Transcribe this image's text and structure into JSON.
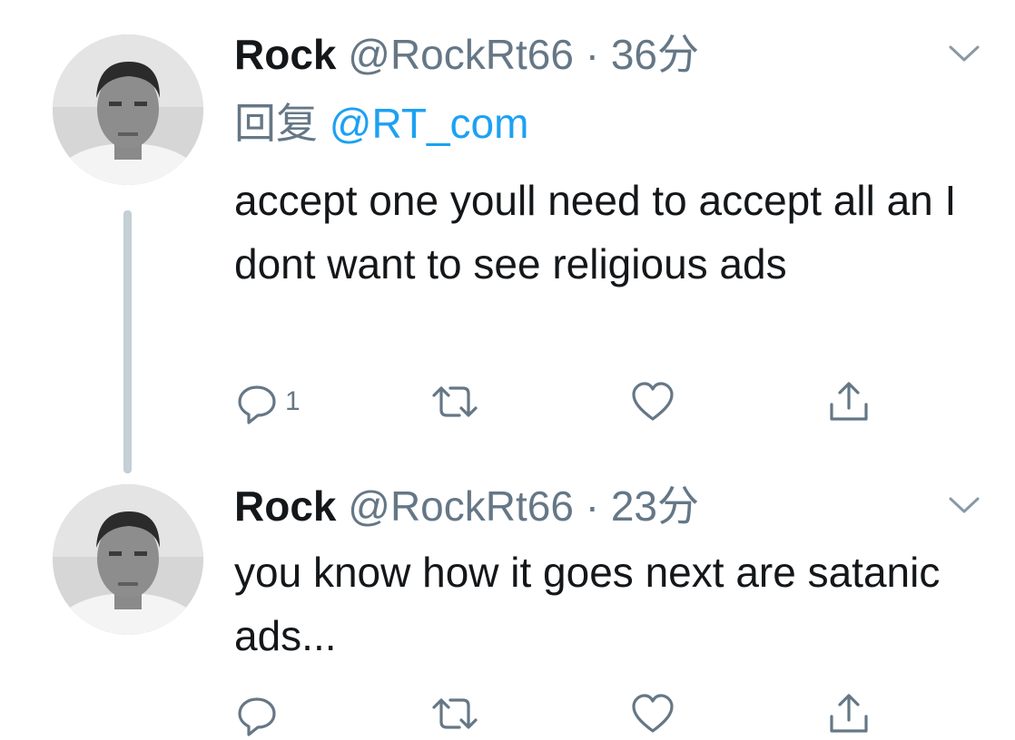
{
  "tweets": [
    {
      "name": "Rock",
      "handle": "@RockRt66",
      "separator": "·",
      "time": "36分",
      "reply_label": "回复",
      "reply_mention": "@RT_com",
      "text": "accept one youll need to accept all an I dont want to see religious ads",
      "reply_count": "1",
      "icons": {
        "reply": "reply-icon",
        "retweet": "retweet-icon",
        "like": "like-icon",
        "share": "share-icon",
        "menu": "chevron-down-icon"
      }
    },
    {
      "name": "Rock",
      "handle": "@RockRt66",
      "separator": "·",
      "time": "23分",
      "text": "you know how it goes  next are satanic ads...",
      "reply_count": "",
      "icons": {
        "reply": "reply-icon",
        "retweet": "retweet-icon",
        "like": "like-icon",
        "share": "share-icon",
        "menu": "chevron-down-icon"
      }
    }
  ],
  "colors": {
    "text": "#14171a",
    "secondary": "#657786",
    "link": "#1da1f2",
    "thread_line": "#c4cfd6",
    "icon": "#657786"
  }
}
